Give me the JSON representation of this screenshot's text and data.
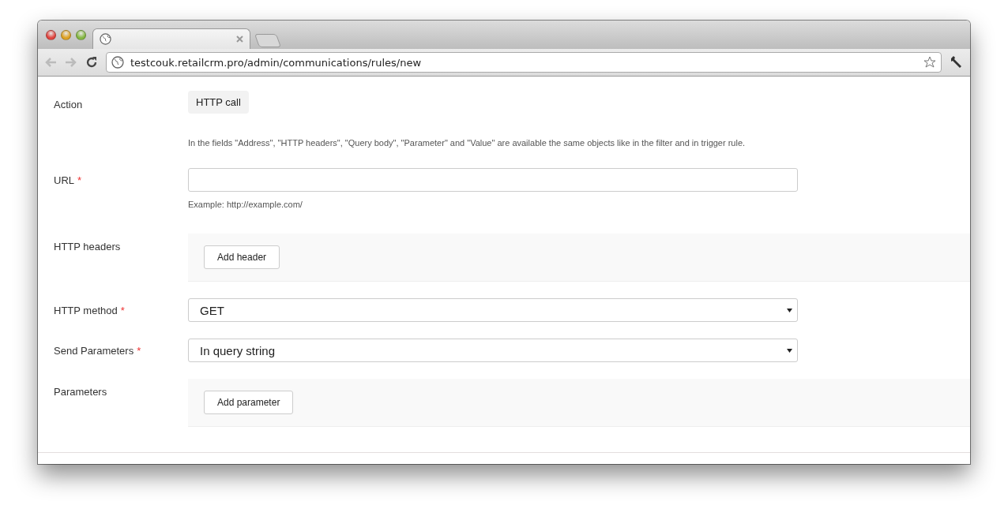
{
  "browser": {
    "address": "testcouk.retailcrm.pro/admin/communications/rules/new"
  },
  "form": [
    {
      "kind": "badge",
      "label": "Action",
      "value": "HTTP call"
    },
    {
      "kind": "note",
      "text": "In the fields \"Address\", \"HTTP headers\", \"Query body\", \"Parameter\" and \"Value\" are available the same objects like in the filter and in trigger rule."
    },
    {
      "kind": "text",
      "label": "URL",
      "required_mark": "*",
      "hint": "Example: http://example.com/"
    },
    {
      "kind": "panel",
      "label": "HTTP headers",
      "button": "Add header"
    },
    {
      "kind": "select",
      "label": "HTTP method",
      "required_mark": "*",
      "value": "GET"
    },
    {
      "kind": "select",
      "label": "Send Parameters",
      "required_mark": "*",
      "value": "In query string"
    },
    {
      "kind": "panel",
      "label": "Parameters",
      "button": "Add parameter"
    }
  ]
}
